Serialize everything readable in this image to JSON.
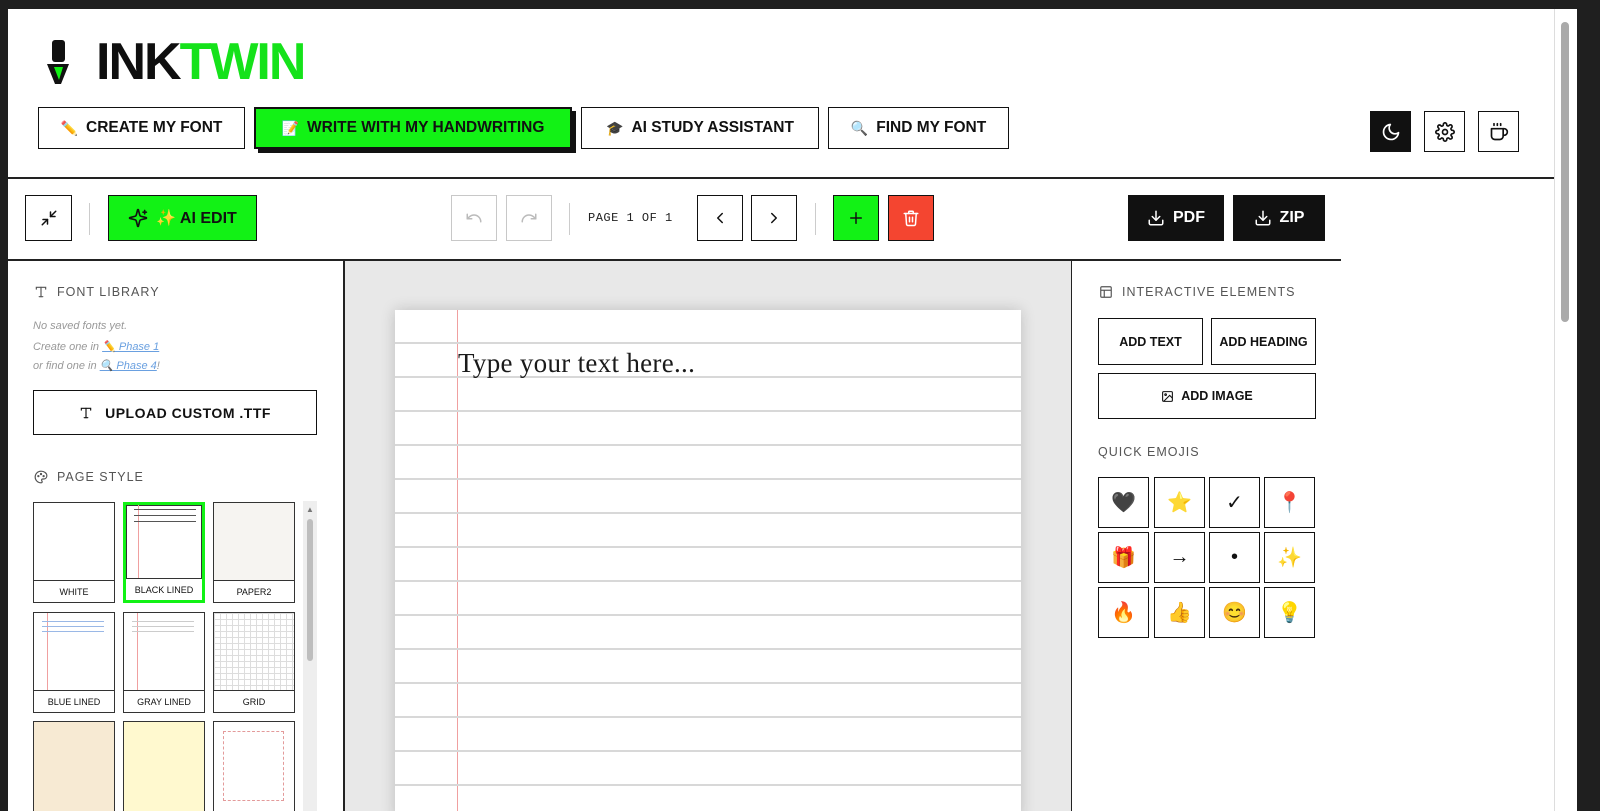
{
  "app": {
    "logo_part1": "INK",
    "logo_part2": "TWIN"
  },
  "nav": [
    {
      "emoji": "✏️",
      "label": "CREATE MY FONT"
    },
    {
      "emoji": "📝",
      "label": "WRITE WITH MY HANDWRITING"
    },
    {
      "emoji": "🎓",
      "label": "AI STUDY ASSISTANT"
    },
    {
      "emoji": "🔍",
      "label": "FIND MY FONT"
    }
  ],
  "toolbar": {
    "ai_edit_label": "✨ AI EDIT",
    "page_indicator": "PAGE 1 OF 1",
    "pdf_label": "PDF",
    "zip_label": "ZIP"
  },
  "font_library": {
    "title": "FONT LIBRARY",
    "empty_line1": "No saved fonts yet.",
    "empty_line2_prefix": "Create one in ",
    "empty_line2_link": "✏️ Phase 1",
    "empty_line3_prefix": "or find one in ",
    "empty_line3_link": "🔍 Phase 4",
    "empty_line3_suffix": "!",
    "upload_label": "UPLOAD CUSTOM .TTF"
  },
  "page_style": {
    "title": "PAGE STYLE",
    "cards": [
      "WHITE",
      "BLACK LINED",
      "PAPER2",
      "BLUE LINED",
      "GRAY LINED",
      "GRID"
    ],
    "selected": "BLACK LINED"
  },
  "editor": {
    "placeholder": "Type your text here..."
  },
  "interactive": {
    "title": "INTERACTIVE ELEMENTS",
    "add_text": "ADD TEXT",
    "add_heading": "ADD HEADING",
    "add_image": "ADD IMAGE",
    "emojis_title": "QUICK EMOJIS",
    "emojis": [
      "🖤",
      "⭐",
      "✓",
      "📍",
      "🎁",
      "→",
      "•",
      "✨",
      "🔥",
      "👍",
      "😊",
      "💡"
    ]
  },
  "colors": {
    "accent": "#12f215",
    "danger": "#f44530",
    "dark": "#111111"
  }
}
